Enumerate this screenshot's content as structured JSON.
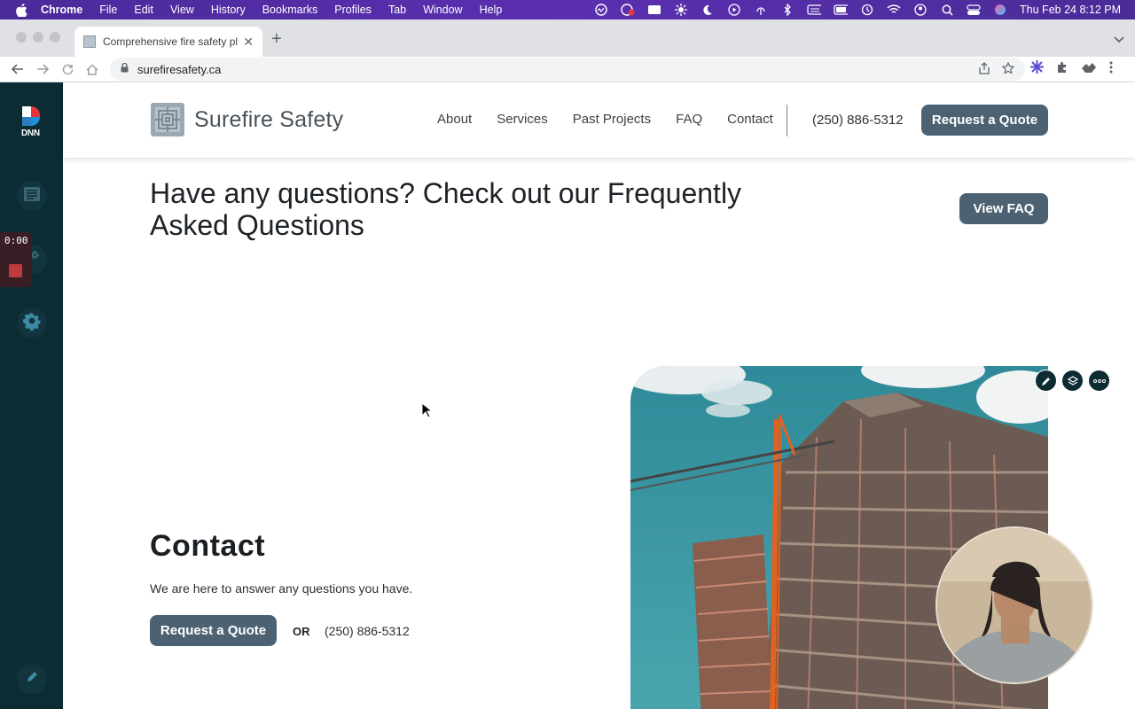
{
  "menubar": {
    "app_name": "Chrome",
    "items": [
      "File",
      "Edit",
      "View",
      "History",
      "Bookmarks",
      "Profiles",
      "Tab",
      "Window",
      "Help"
    ],
    "clock": "Thu Feb 24  8:12 PM"
  },
  "browser": {
    "tab_title": "Comprehensive fire safety plan",
    "url": "surefiresafety.ca"
  },
  "dnn": {
    "logo_text": "DNN",
    "timer": "0:00"
  },
  "site": {
    "brand": "Surefire Safety",
    "nav": [
      "About",
      "Services",
      "Past Projects",
      "FAQ",
      "Contact"
    ],
    "phone": "(250) 886-5312",
    "cta": "Request a Quote"
  },
  "faq": {
    "heading": "Have any questions? Check out our Frequently Asked Questions",
    "button": "View FAQ"
  },
  "contact": {
    "title": "Contact",
    "text": "We are here to answer any questions you have.",
    "cta": "Request a Quote",
    "or": "OR",
    "phone": "(250) 886-5312"
  },
  "colors": {
    "sidebar": "#0d2b33",
    "button": "#4c6272",
    "menubar": "#4b2a9a"
  }
}
